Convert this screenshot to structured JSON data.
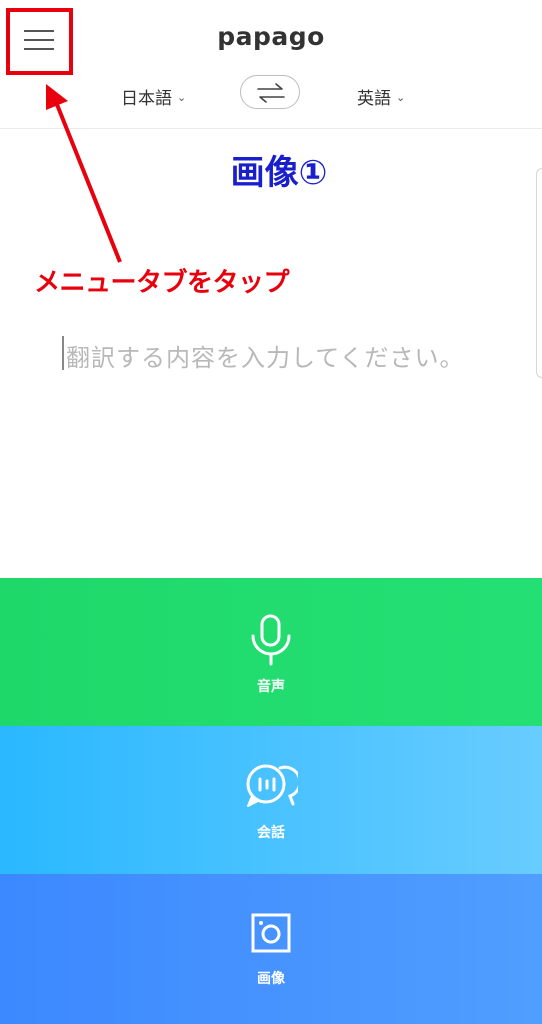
{
  "app": {
    "logo": "papago"
  },
  "header": {
    "source_lang": "日本語",
    "target_lang": "英語",
    "chevron": "⌄"
  },
  "annotation": {
    "title": "画像①",
    "label": "メニュータブをタップ",
    "color": "#e8000c",
    "title_color": "#1a1fcc"
  },
  "input": {
    "placeholder": "翻訳する内容を入力してください。"
  },
  "modes": {
    "voice": {
      "label": "音声",
      "icon": "microphone-icon",
      "color": "#22dc6f"
    },
    "conversation": {
      "label": "会話",
      "icon": "chat-bubbles-icon",
      "color": "#3fbfff"
    },
    "image": {
      "label": "画像",
      "icon": "camera-icon",
      "color": "#4690ff"
    }
  }
}
